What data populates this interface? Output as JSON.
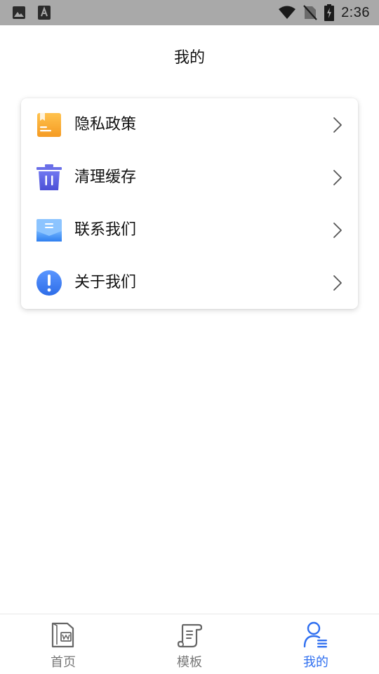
{
  "status_bar": {
    "time": "2:36",
    "left_icons": [
      "image-icon",
      "font-icon"
    ],
    "right_icons": [
      "wifi-icon",
      "no-sim-icon",
      "battery-charging-icon"
    ]
  },
  "header": {
    "title": "我的"
  },
  "menu": {
    "items": [
      {
        "label": "隐私政策",
        "icon": "privacy-book-icon",
        "icon_color": "#f5a623"
      },
      {
        "label": "清理缓存",
        "icon": "trash-icon",
        "icon_color": "#5b5fe0"
      },
      {
        "label": "联系我们",
        "icon": "mail-icon",
        "icon_color": "#3d8ef5"
      },
      {
        "label": "关于我们",
        "icon": "info-icon",
        "icon_color": "#3a7bf2"
      }
    ]
  },
  "tab_bar": {
    "tabs": [
      {
        "label": "首页",
        "icon": "document-icon",
        "active": false
      },
      {
        "label": "模板",
        "icon": "scroll-template-icon",
        "active": false
      },
      {
        "label": "我的",
        "icon": "user-profile-icon",
        "active": true
      }
    ],
    "active_color": "#2f6ff0",
    "inactive_color": "#777777"
  }
}
